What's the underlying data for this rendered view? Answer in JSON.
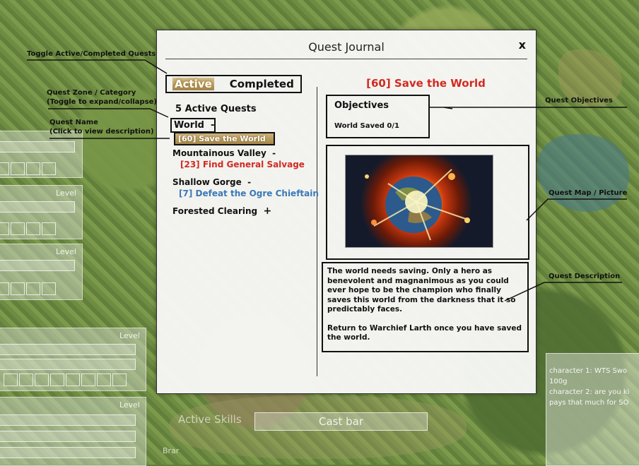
{
  "background_hud": {
    "level_labels": [
      "Level",
      "Level",
      "Level",
      "Level"
    ],
    "chat_lines": [
      "character 1: WTS Swo",
      "100g",
      "character 2: are you ki",
      "pays that much for SO"
    ],
    "cast_bar_label": "Cast bar",
    "active_skills_label": "Active Skills",
    "skill_slot_label": "Brar"
  },
  "journal": {
    "title": "Quest Journal",
    "close_label": "x",
    "tabs": {
      "active": "Active",
      "completed": "Completed"
    },
    "quest_count": "5 Active Quests",
    "zones": [
      {
        "name": "World",
        "toggle": "-",
        "quests": [
          {
            "label": "[60] Save the World",
            "color": "#ffffff"
          }
        ]
      },
      {
        "name": "Mountainous Valley",
        "toggle": "-",
        "quests": [
          {
            "label": "[23] Find General Salvage",
            "color": "#d22a22"
          }
        ]
      },
      {
        "name": "Shallow Gorge",
        "toggle": "-",
        "quests": [
          {
            "label": "[7] Defeat the Ogre Chieftain",
            "color": "#3a78b8"
          }
        ]
      },
      {
        "name": "Forested Clearing",
        "toggle": "+",
        "quests": []
      }
    ],
    "detail": {
      "title": "[60] Save the World",
      "objectives_heading": "Objectives",
      "objective_line": "World Saved  0/1",
      "description_p1": "The world needs saving. Only a hero as  benevolent and magnanimous as you could ever hope to be the champion who finally saves this world from the darkness that it so predictably faces.",
      "description_p2": "Return to Warchief Larth once you have saved the world.",
      "picture_icon": "exploding-planet-image"
    }
  },
  "annotations": {
    "toggle": "Toggle Active/Completed Quests",
    "zone_1": "Quest Zone / Category",
    "zone_2": "(Toggle to expand/collapse)",
    "name_1": "Quest Name",
    "name_2": "(Click to view description)",
    "objectives": "Quest Objectives",
    "map": "Quest Map / Picture",
    "description": "Quest Description"
  },
  "colors": {
    "title_red": "#d22a22",
    "quest_blue": "#3a78b8",
    "active_tab_gold": "#a6874c"
  }
}
